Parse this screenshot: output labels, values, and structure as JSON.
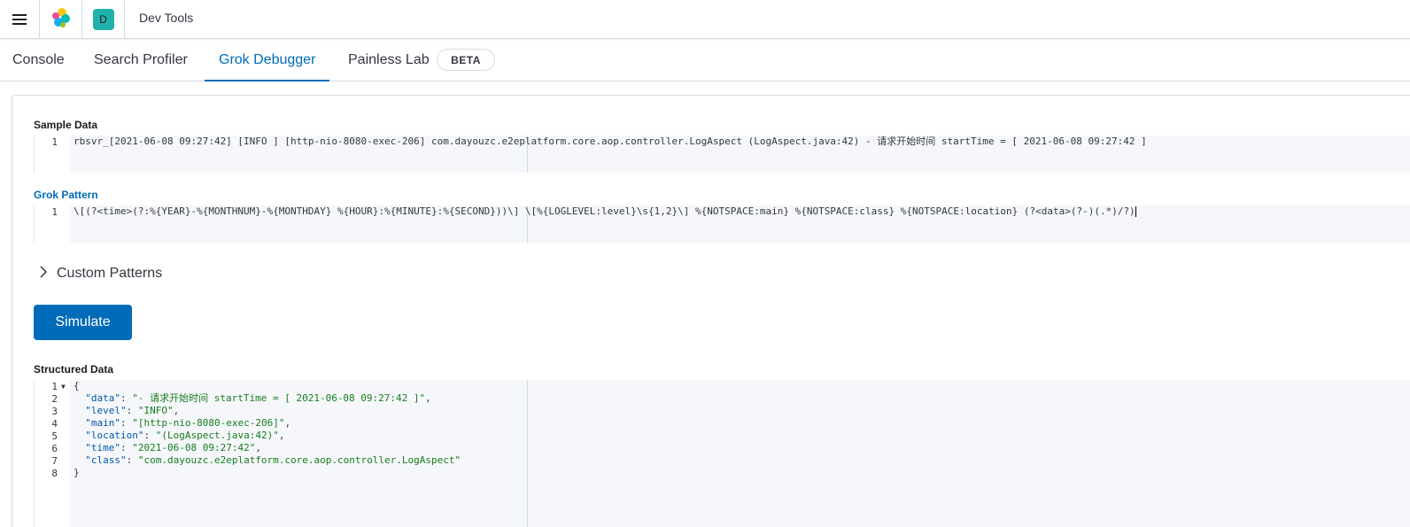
{
  "header": {
    "app_title": "Dev Tools",
    "space_initial": "D"
  },
  "tabs": [
    {
      "label": "Console"
    },
    {
      "label": "Search Profiler"
    },
    {
      "label": "Grok Debugger"
    },
    {
      "label": "Painless Lab"
    }
  ],
  "badge": "BETA",
  "sample_data": {
    "label": "Sample Data",
    "line_number": "1",
    "value": "rbsvr_[2021-06-08 09:27:42] [INFO ] [http-nio-8080-exec-206] com.dayouzc.e2eplatform.core.aop.controller.LogAspect (LogAspect.java:42) - 请求开始时间 startTime = [ 2021-06-08 09:27:42 ]"
  },
  "grok_pattern": {
    "label": "Grok Pattern",
    "line_number": "1",
    "value": "\\[(?<time>(?:%{YEAR}-%{MONTHNUM}-%{MONTHDAY} %{HOUR}:%{MINUTE}:%{SECOND}))\\] \\[%{LOGLEVEL:level}\\s{1,2}\\] %{NOTSPACE:main} %{NOTSPACE:class} %{NOTSPACE:location} (?<data>(?-)(.*)/?)"
  },
  "custom_patterns": {
    "label": "Custom Patterns"
  },
  "simulate_label": "Simulate",
  "structured_data": {
    "label": "Structured Data",
    "line_numbers": [
      "1",
      "2",
      "3",
      "4",
      "5",
      "6",
      "7",
      "8"
    ],
    "open_brace": "{",
    "close_brace": "}",
    "entries": [
      {
        "key": "\"data\"",
        "value": "\"- 请求开始时间 startTime = [ 2021-06-08 09:27:42 ]\"",
        "sep": ","
      },
      {
        "key": "\"level\"",
        "value": "\"INFO\"",
        "sep": ","
      },
      {
        "key": "\"main\"",
        "value": "\"[http-nio-8080-exec-206]\"",
        "sep": ","
      },
      {
        "key": "\"location\"",
        "value": "\"(LogAspect.java:42)\"",
        "sep": ","
      },
      {
        "key": "\"time\"",
        "value": "\"2021-06-08 09:27:42\"",
        "sep": ","
      },
      {
        "key": "\"class\"",
        "value": "\"com.dayouzc.e2eplatform.core.aop.controller.LogAspect\"",
        "sep": ""
      }
    ]
  },
  "colors": {
    "accent": "#006bb8",
    "avatar": "#20b2aa",
    "json_key": "#0057a8",
    "json_string": "#177c1e"
  },
  "icons": [
    "menu-icon",
    "elastic-logo-icon",
    "chevron-right-icon",
    "fold-arrow-icon"
  ]
}
